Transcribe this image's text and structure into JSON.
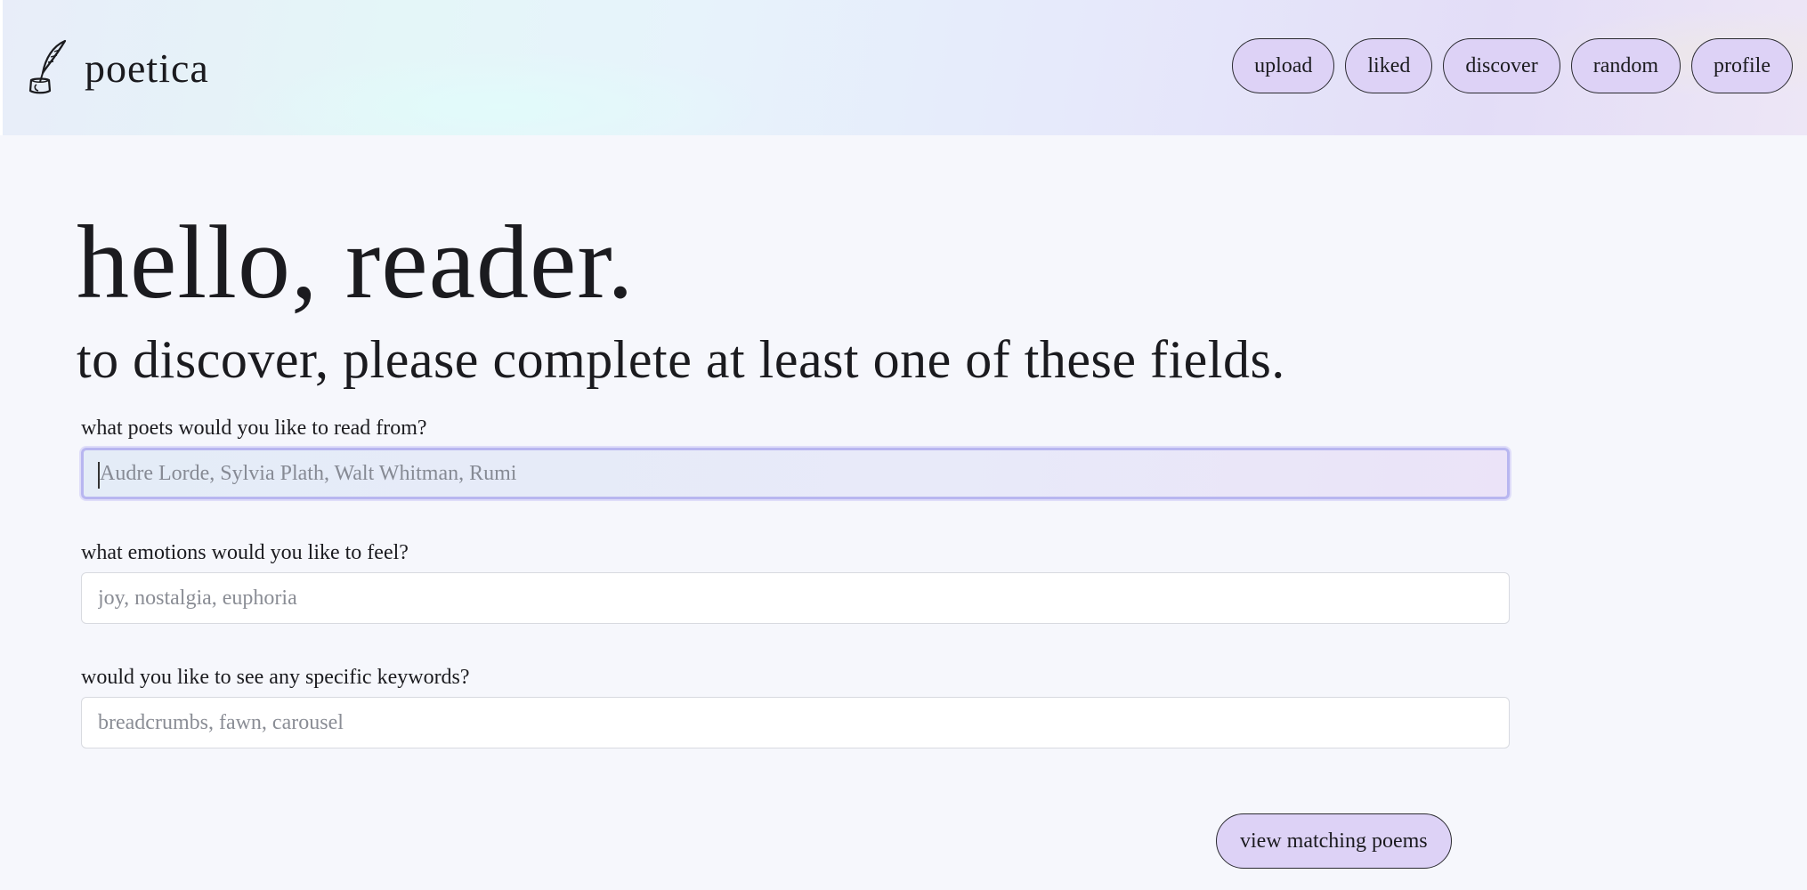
{
  "app": {
    "name": "poetica",
    "logo_icon": "quill-inkwell-icon"
  },
  "nav": [
    {
      "label": "upload"
    },
    {
      "label": "liked"
    },
    {
      "label": "discover"
    },
    {
      "label": "random"
    },
    {
      "label": "profile"
    }
  ],
  "hero": {
    "title": "hello, reader.",
    "subtitle": "to discover, please complete at least one of these fields."
  },
  "form": {
    "poets": {
      "label": "what poets would you like to read from?",
      "placeholder": "Audre Lorde, Sylvia Plath, Walt Whitman, Rumi",
      "focused": true
    },
    "emotions": {
      "label": "what emotions would you like to feel?",
      "placeholder": "joy, nostalgia, euphoria"
    },
    "keywords": {
      "label": "would you like to see any specific keywords?",
      "placeholder": "breadcrumbs, fawn, carousel"
    },
    "submit_label": "view matching poems"
  },
  "colors": {
    "accent": "#ddd2f6",
    "background": "#f6f7fc",
    "text": "#1b1b1f"
  }
}
